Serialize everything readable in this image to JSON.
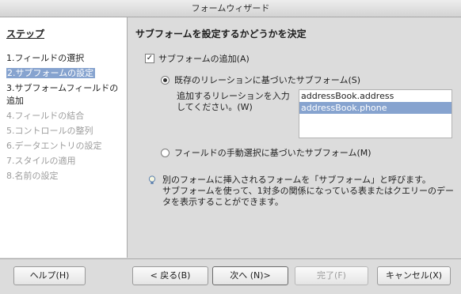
{
  "window": {
    "title": "フォームウィザード"
  },
  "steps": {
    "heading": "ステップ",
    "items": [
      {
        "label": "1.フィールドの選択",
        "state": "normal"
      },
      {
        "label": "2.サブフォームの設定",
        "state": "active"
      },
      {
        "label": "3.サブフォームフィールドの追加",
        "state": "normal"
      },
      {
        "label": "4.フィールドの結合",
        "state": "disabled"
      },
      {
        "label": "5.コントロールの整列",
        "state": "disabled"
      },
      {
        "label": "6.データエントリの設定",
        "state": "disabled"
      },
      {
        "label": "7.スタイルの適用",
        "state": "disabled"
      },
      {
        "label": "8.名前の設定",
        "state": "disabled"
      }
    ]
  },
  "main": {
    "title": "サブフォームを設定するかどうかを決定",
    "add_subform": {
      "label": "サブフォームの追加(A)",
      "checked": true
    },
    "radio_existing": {
      "label": "既存のリレーションに基づいたサブフォーム(S)",
      "checked": true
    },
    "relation_label": "追加するリレーションを入力してください。(W)",
    "relations": [
      {
        "label": "addressBook.address",
        "selected": false
      },
      {
        "label": "addressBook.phone",
        "selected": true
      }
    ],
    "radio_manual": {
      "label": "フィールドの手動選択に基づいたサブフォーム(M)",
      "checked": false
    },
    "info_icon": "lightbulb-icon",
    "info_lines": [
      "別のフォームに挿入されるフォームを「サブフォーム」と呼びます。",
      "サブフォームを使って、1対多の関係になっている表またはクエリーのデー",
      "タを表示することができます。"
    ]
  },
  "buttons": {
    "help": "ヘルプ(H)",
    "back": "< 戻る(B)",
    "next": "次へ (N)>",
    "finish": "完了(F)",
    "cancel": "キャンセル(X)"
  },
  "colors": {
    "selection": "#86a3cf",
    "disabled_text": "#9c9c9c"
  }
}
